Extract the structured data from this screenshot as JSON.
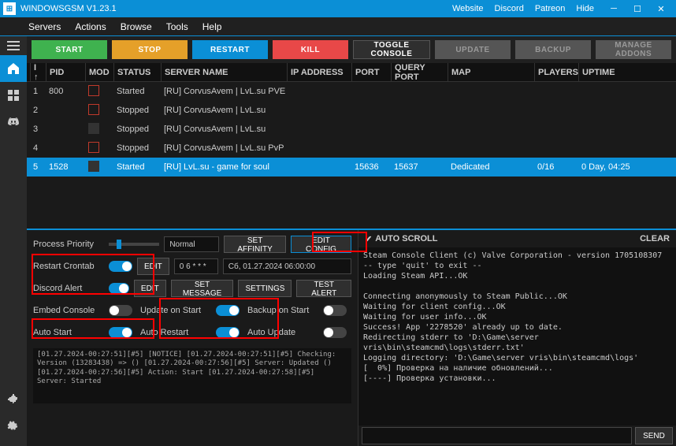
{
  "titlebar": {
    "title": "WINDOWSGSM V1.23.1",
    "links": [
      "Website",
      "Discord",
      "Patreon",
      "Hide"
    ]
  },
  "menu": [
    "Servers",
    "Actions",
    "Browse",
    "Tools",
    "Help"
  ],
  "actions": {
    "start": "START",
    "stop": "STOP",
    "restart": "RESTART",
    "kill": "KILL",
    "toggle": "TOGGLE CONSOLE",
    "update": "UPDATE",
    "backup": "BACKUP",
    "manage": "MANAGE ADDONS"
  },
  "table": {
    "headers": [
      "I ↑",
      "PID",
      "MOD",
      "STATUS",
      "SERVER NAME",
      "IP ADDRESS",
      "PORT",
      "QUERY PORT",
      "MAP",
      "PLAYERS",
      "UPTIME"
    ],
    "rows": [
      {
        "idx": "1",
        "pid": "800",
        "status": "Started",
        "name": "[RU] CorvusAvem | LvL.su PVE",
        "ip": "",
        "port": "",
        "qport": "",
        "map": "",
        "players": "",
        "uptime": "",
        "redacted": true
      },
      {
        "idx": "2",
        "pid": "",
        "status": "Stopped",
        "name": "[RU] CorvusAvem | LvL.su",
        "ip": "",
        "port": "",
        "qport": "",
        "map": "",
        "players": "",
        "uptime": "",
        "redacted": true
      },
      {
        "idx": "3",
        "pid": "",
        "status": "Stopped",
        "name": "[RU] CorvusAvem | LvL.su",
        "ip": "",
        "port": "",
        "qport": "",
        "map": "",
        "players": "",
        "uptime": "",
        "redacted": true
      },
      {
        "idx": "4",
        "pid": "",
        "status": "Stopped",
        "name": "[RU] CorvusAvem | LvL.su PvP",
        "ip": "",
        "port": "",
        "qport": "",
        "map": "",
        "players": "",
        "uptime": "",
        "redacted": true
      },
      {
        "idx": "5",
        "pid": "1528",
        "status": "Started",
        "name": "[RU] LvL.su - game for soul",
        "ip": "",
        "port": "15636",
        "qport": "15637",
        "map": "Dedicated",
        "players": "0/16",
        "uptime": "0 Day, 04:25",
        "redacted_ip": true,
        "selected": true
      }
    ]
  },
  "settings": {
    "priority_label": "Process Priority",
    "priority_value": "Normal",
    "set_affinity": "SET AFFINITY",
    "edit_config": "EDIT CONFIG",
    "restart_crontab": "Restart Crontab",
    "edit": "EDIT",
    "crontab_value": "0 6 * * *",
    "crontab_time": "Сб, 01.27.2024 06:00:00",
    "discord_alert": "Discord Alert",
    "set_message": "SET MESSAGE",
    "settings_btn": "SETTINGS",
    "test_alert": "TEST ALERT",
    "embed_console": "Embed Console",
    "update_on_start": "Update on Start",
    "backup_on_start": "Backup on Start",
    "auto_start": "Auto Start",
    "auto_restart": "Auto Restart",
    "auto_update": "Auto Update"
  },
  "mini_log": [
    "[01.27.2024-00:27:51][#5] [NOTICE]",
    "[01.27.2024-00:27:51][#5] Checking: Version (13283438) => ()",
    "[01.27.2024-00:27:56][#5] Server: Updated ()",
    "[01.27.2024-00:27:56][#5] Action: Start",
    "[01.27.2024-00:27:58][#5] Server: Started"
  ],
  "console": {
    "auto_scroll": "AUTO SCROLL",
    "clear": "CLEAR",
    "send": "SEND",
    "lines": [
      "Steam Console Client (c) Valve Corporation - version 1705108307",
      "-- type 'quit' to exit --",
      "Loading Steam API...OK",
      "",
      "Connecting anonymously to Steam Public...OK",
      "Waiting for client config...OK",
      "Waiting for user info...OK",
      "Success! App '2278520' already up to date.",
      "Redirecting stderr to 'D:\\Game\\server vris\\bin\\steamcmd\\logs\\stderr.txt'",
      "Logging directory: 'D:\\Game\\server vris\\bin\\steamcmd\\logs'",
      "[  0%] Проверка на наличие обновлений...",
      "[----] Проверка установки..."
    ]
  }
}
